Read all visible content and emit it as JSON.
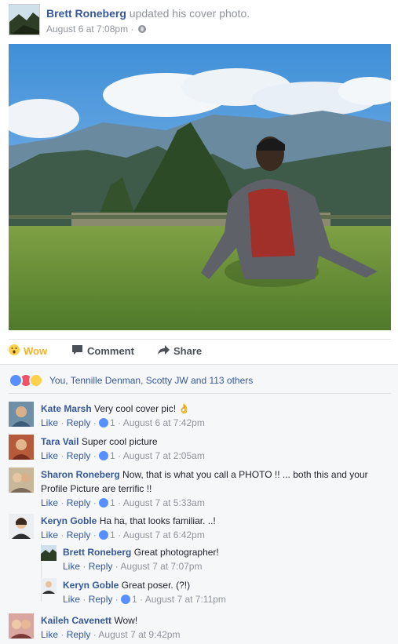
{
  "post": {
    "author": "Brett Roneberg",
    "action": "updated his cover photo.",
    "date": "August 6 at 7:08pm",
    "date_sep": "·"
  },
  "actions": {
    "wow": "Wow",
    "comment": "Comment",
    "share": "Share"
  },
  "reactions": {
    "summary": "You, Tennille Denman, Scotty JW and 113 others"
  },
  "comments": [
    {
      "name": "Kate Marsh",
      "text": "Very cool cover pic! 👌",
      "like": "Like",
      "reply": "Reply",
      "likes": "1",
      "time": "August 6 at 7:42pm"
    },
    {
      "name": "Tara Vail",
      "text": "Super cool picture",
      "like": "Like",
      "reply": "Reply",
      "likes": "1",
      "time": "August 7 at 2:05am"
    },
    {
      "name": "Sharon Roneberg",
      "text": "Now, that is what you call a PHOTO !! ... both this and your Profile Picture are terrific !!",
      "like": "Like",
      "reply": "Reply",
      "likes": "1",
      "time": "August 7 at 5:33am"
    },
    {
      "name": "Keryn Goble",
      "text": "Ha ha, that looks familiar. ..!",
      "like": "Like",
      "reply": "Reply",
      "likes": "1",
      "time": "August 7 at 6:42pm"
    },
    {
      "name": "Brett Roneberg",
      "text": "Great photographer!",
      "like": "Like",
      "reply": "Reply",
      "time": "August 7 at 7:07pm"
    },
    {
      "name": "Keryn Goble",
      "text": "Great poser. (?!)",
      "like": "Like",
      "reply": "Reply",
      "likes": "1",
      "time": "August 7 at 7:11pm"
    },
    {
      "name": "Kaileh Cavenett",
      "text": "Wow!",
      "like": "Like",
      "reply": "Reply",
      "time": "August 7 at 9:42pm"
    }
  ],
  "icons": {
    "wow": "wow-reaction-icon",
    "comment": "comment-icon",
    "share": "share-arrow-icon",
    "globe": "globe-icon",
    "like_badge": "like-thumb-icon"
  },
  "colors": {
    "link": "#365899",
    "meta": "#90949c",
    "like_blue": "#5890ff",
    "love_red": "#f25268",
    "wow_yellow": "#f7b125"
  }
}
